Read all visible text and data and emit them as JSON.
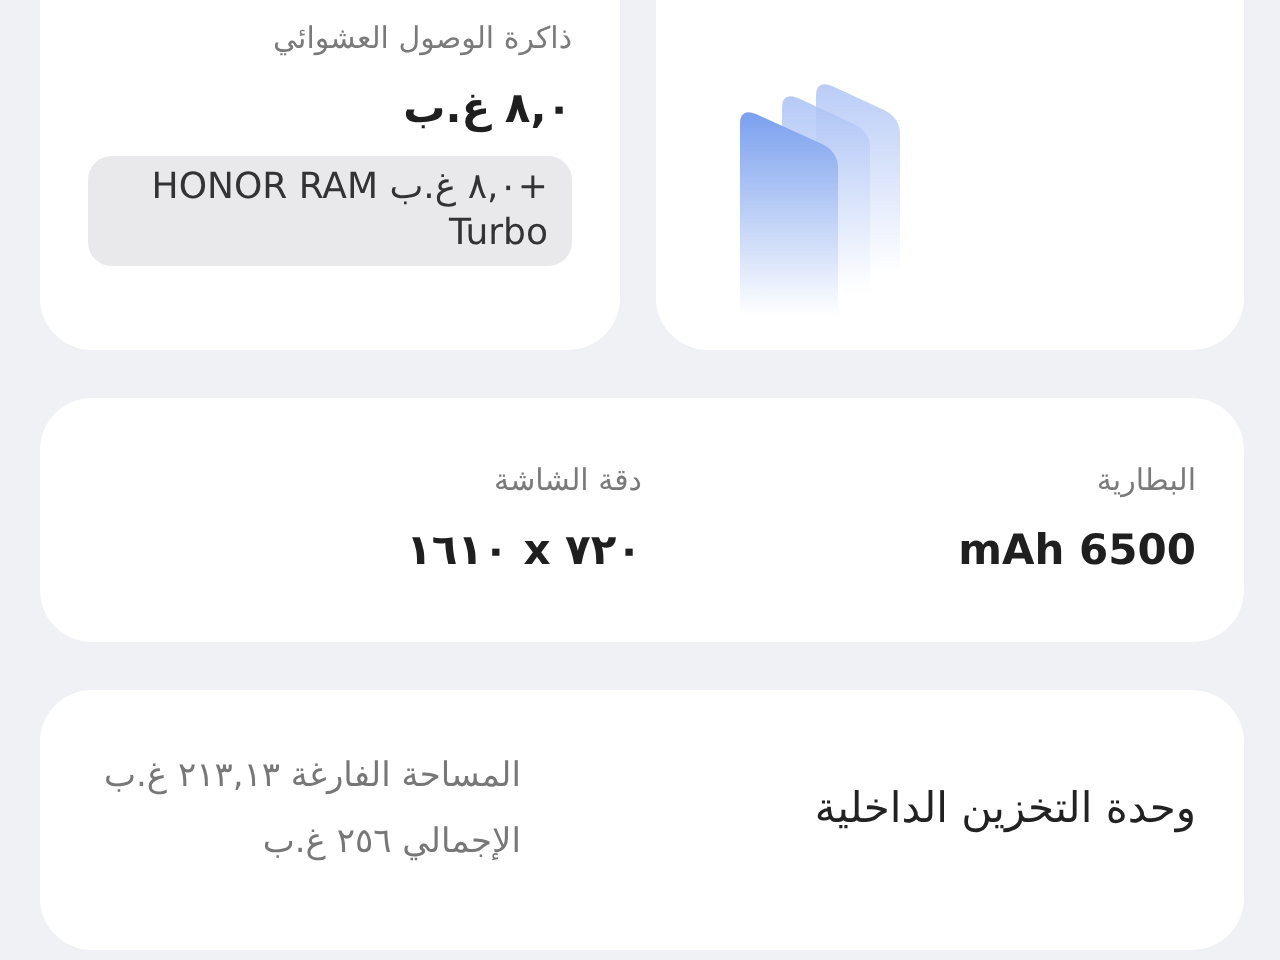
{
  "ram_card": {
    "label": "ذاكرة الوصول العشوائي",
    "value": "٨,٠ غ.ب",
    "turbo_note": "+٨,٠ غ.ب HONOR RAM Turbo"
  },
  "specs": [
    {
      "label": "البطارية",
      "value": "6500 mAh"
    },
    {
      "label": "دقة الشاشة",
      "value": "٧٢٠ x ١٦١٠"
    }
  ],
  "storage": {
    "title": "وحدة التخزين الداخلية",
    "lines": [
      "المساحة الفارغة ٢١٣,١٣ غ.ب",
      "الإجمالي ٢٥٦ غ.ب"
    ]
  }
}
